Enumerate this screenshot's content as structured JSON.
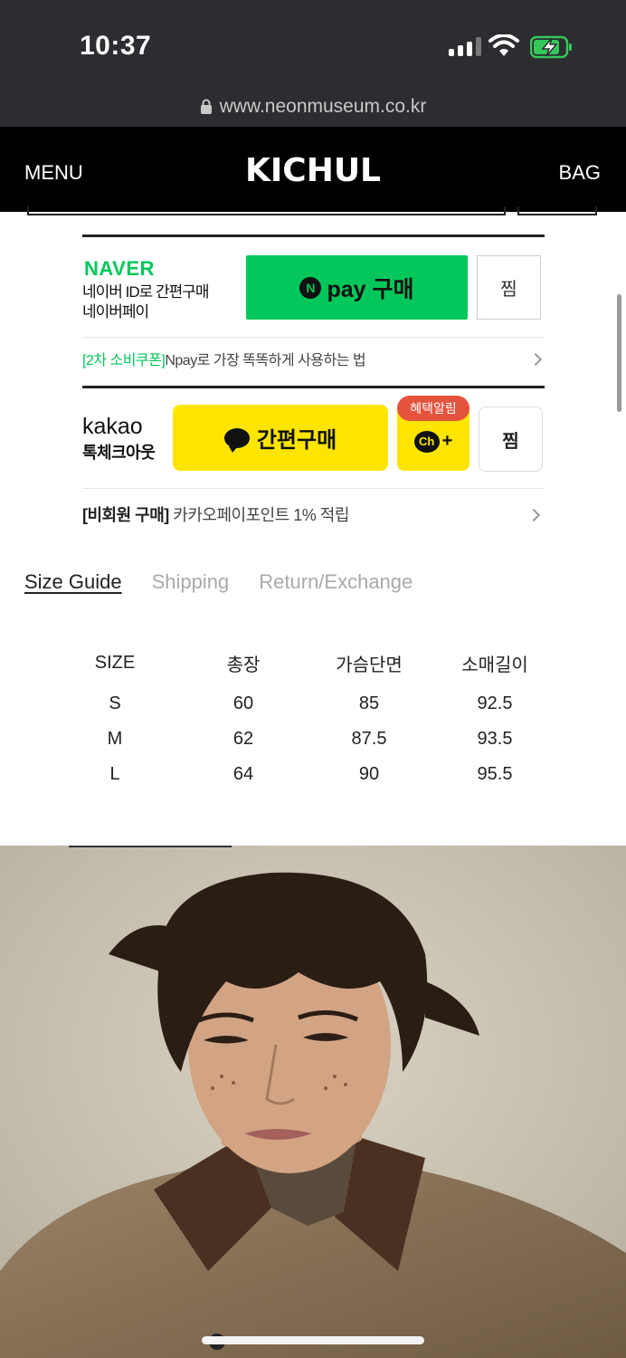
{
  "status_bar": {
    "time": "10:37"
  },
  "browser": {
    "url": "www.neonmuseum.co.kr"
  },
  "header": {
    "menu_label": "MENU",
    "logo": "KICHUL",
    "bag_label": "BAG"
  },
  "naver": {
    "brand": "NAVER",
    "desc_line1": "네이버 ID로 간편구매",
    "desc_line2": "네이버페이",
    "pay_button": "pay 구매",
    "pay_icon_letter": "N",
    "wishlist_button": "찜",
    "coupon_highlight": "[2차 소비쿠폰]",
    "coupon_text": "Npay로 가장 똑똑하게 사용하는 법"
  },
  "kakao": {
    "brand": "kakao",
    "subtitle": "톡체크아웃",
    "buy_button": "간편구매",
    "channel_badge": "혜택알림",
    "channel_label": "Ch",
    "channel_plus": "+",
    "wishlist_button": "찜",
    "point_highlight": "[비회원 구매]",
    "point_text": " 카카오페이포인트 1% 적립"
  },
  "tabs": [
    {
      "label": "Size Guide",
      "active": true
    },
    {
      "label": "Shipping",
      "active": false
    },
    {
      "label": "Return/Exchange",
      "active": false
    }
  ],
  "size_table": {
    "headers": [
      "SIZE",
      "총장",
      "가슴단면",
      "소매길이"
    ],
    "rows": [
      [
        "S",
        "60",
        "85",
        "92.5"
      ],
      [
        "M",
        "62",
        "87.5",
        "93.5"
      ],
      [
        "L",
        "64",
        "90",
        "95.5"
      ]
    ]
  },
  "colors": {
    "naver_green": "#03c75a",
    "kakao_yellow": "#fee500",
    "badge_red": "#e5533d",
    "status_bg": "#2b2d30"
  }
}
